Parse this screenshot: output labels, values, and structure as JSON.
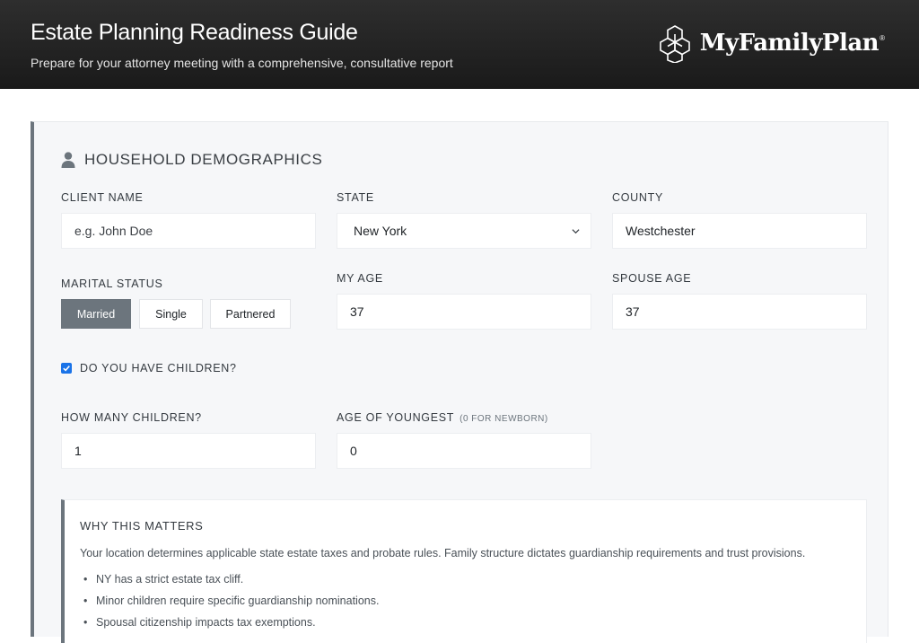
{
  "header": {
    "title": "Estate Planning Readiness Guide",
    "subtitle": "Prepare for your attorney meeting with a comprehensive, consultative report",
    "brand_name": "MyFamilyPlan",
    "brand_mark": "®",
    "logo_icon": "hexagon-cube-logo-icon"
  },
  "section": {
    "title": "HOUSEHOLD DEMOGRAPHICS",
    "icon": "person-icon"
  },
  "fields": {
    "client_name": {
      "label": "CLIENT NAME",
      "placeholder": "e.g. John Doe",
      "value": ""
    },
    "state": {
      "label": "STATE",
      "value": "New York"
    },
    "county": {
      "label": "COUNTY",
      "value": "Westchester"
    },
    "marital_status": {
      "label": "MARITAL STATUS",
      "options": [
        "Married",
        "Single",
        "Partnered"
      ],
      "selected": "Married"
    },
    "my_age": {
      "label": "MY AGE",
      "value": "37"
    },
    "spouse_age": {
      "label": "SPOUSE AGE",
      "value": "37"
    },
    "has_children": {
      "label": "DO YOU HAVE CHILDREN?",
      "checked": true
    },
    "how_many_children": {
      "label": "HOW MANY CHILDREN?",
      "value": "1"
    },
    "age_of_youngest": {
      "label": "AGE OF YOUNGEST",
      "hint": "(0 FOR NEWBORN)",
      "value": "0"
    }
  },
  "why_box": {
    "title": "WHY THIS MATTERS",
    "text": "Your location determines applicable state estate taxes and probate rules. Family structure dictates guardianship requirements and trust provisions.",
    "bullets": [
      "NY has a strict estate tax cliff.",
      "Minor children require specific guardianship nominations.",
      "Spousal citizenship impacts tax exemptions."
    ]
  },
  "colors": {
    "header_bg": "#1f1f1f",
    "accent_gray": "#6c757d",
    "checkbox_blue": "#1a73e8",
    "panel_bg": "#f6f7f9"
  }
}
